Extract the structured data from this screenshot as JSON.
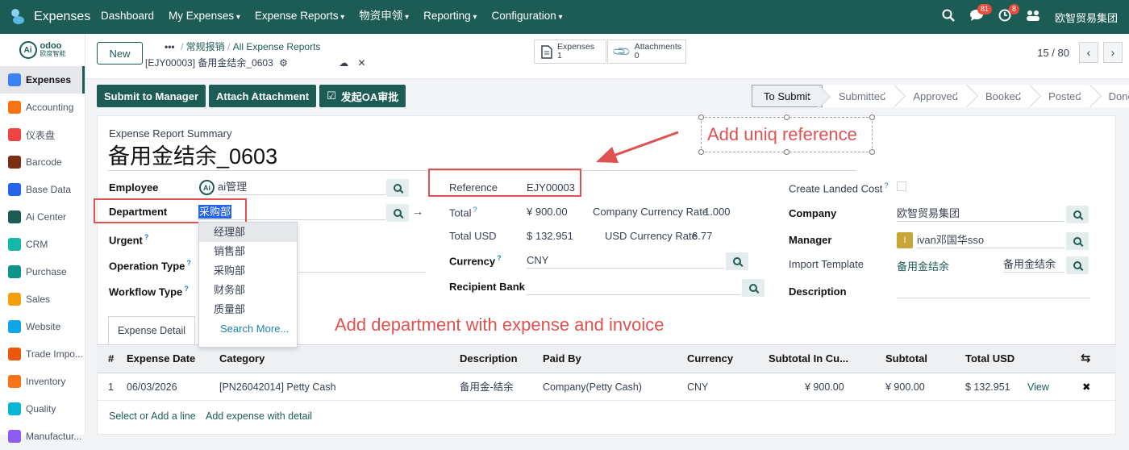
{
  "topbar": {
    "app_name": "Expenses",
    "menus": [
      "Dashboard",
      "My Expenses",
      "Expense Reports",
      "物资申领",
      "Reporting",
      "Configuration"
    ],
    "chat_count": "81",
    "activity_count": "8",
    "company": "欧智贸易集团"
  },
  "sidebar": {
    "logo_text": "odoo",
    "logo_sub": "欧度智能",
    "items": [
      {
        "label": "Expenses",
        "color": "#3b82f6"
      },
      {
        "label": "Accounting",
        "color": "#f97316"
      },
      {
        "label": "仪表盘",
        "color": "#ef4444"
      },
      {
        "label": "Barcode",
        "color": "#7c2d12"
      },
      {
        "label": "Base Data",
        "color": "#2563eb"
      },
      {
        "label": "Ai Center",
        "color": "#1d5c55"
      },
      {
        "label": "CRM",
        "color": "#14b8a6"
      },
      {
        "label": "Purchase",
        "color": "#0d9488"
      },
      {
        "label": "Sales",
        "color": "#f59e0b"
      },
      {
        "label": "Website",
        "color": "#0ea5e9"
      },
      {
        "label": "Trade Impo...",
        "color": "#ea580c"
      },
      {
        "label": "Inventory",
        "color": "#f97316"
      },
      {
        "label": "Quality",
        "color": "#06b6d4"
      },
      {
        "label": "Manufactur...",
        "color": "#8b5cf6"
      }
    ]
  },
  "control_panel": {
    "new_label": "New",
    "breadcrumb_more": "•••",
    "breadcrumb_1": "常规报销",
    "breadcrumb_2": "All Expense Reports",
    "record_name": "[EJY00003] 备用金结余_0603",
    "smart_expenses_label": "Expenses",
    "smart_expenses_count": "1",
    "smart_attach_label": "Attachments",
    "smart_attach_count": "0",
    "pager": "15 / 80"
  },
  "actions": [
    "Submit to Manager",
    "Attach Attachment",
    "发起OA审批"
  ],
  "status_steps": [
    "To Submit",
    "Submitted",
    "Approved",
    "Booked",
    "Posted",
    "Done"
  ],
  "form": {
    "summary_label": "Expense Report Summary",
    "summary": "备用金结余_0603",
    "employee_label": "Employee",
    "employee": "ai管理",
    "department_label": "Department",
    "department": "采购部",
    "urgent_label": "Urgent",
    "operation_type_label": "Operation Type",
    "workflow_type_label": "Workflow Type",
    "reference_label": "Reference",
    "reference": "EJY00003",
    "total_label": "Total",
    "total": "¥ 900.00",
    "ccr_label": "Company Currency Rate",
    "ccr": "1.000",
    "total_usd_label": "Total USD",
    "total_usd": "$ 132.951",
    "usd_rate_label": "USD Currency Rate",
    "usd_rate": "6.77",
    "currency_label": "Currency",
    "currency": "CNY",
    "recipient_bank_label": "Recipient Bank",
    "landed_cost_label": "Create Landed Cost",
    "company_label": "Company",
    "company": "欧智贸易集团",
    "manager_label": "Manager",
    "manager": "ivan邓国华sso",
    "manager_initial": "I",
    "import_template_label": "Import Template",
    "import_template": "备用金结余",
    "import_template_2": "备用金结余",
    "description_label": "Description"
  },
  "department_dropdown": {
    "options": [
      "经理部",
      "销售部",
      "采购部",
      "财务部",
      "质量部"
    ],
    "search_more": "Search More..."
  },
  "tab": {
    "label": "Expense Detail"
  },
  "table": {
    "headers": [
      "#",
      "Expense Date",
      "Category",
      "Description",
      "Paid By",
      "Currency",
      "Subtotal In Cu...",
      "Subtotal",
      "Total USD"
    ],
    "rows": [
      [
        "1",
        "06/03/2026",
        "[PN26042014] Petty Cash",
        "备用金-结余",
        "Company(Petty Cash)",
        "CNY",
        "¥ 900.00",
        "¥ 900.00",
        "$ 132.951",
        "View"
      ]
    ],
    "add_line": "Select or Add a line",
    "add_detail": "Add expense with detail"
  },
  "annotations": {
    "uniq_reference": "Add uniq reference",
    "department_note": "Add department with expense and invoice",
    "color": "#e05252"
  }
}
